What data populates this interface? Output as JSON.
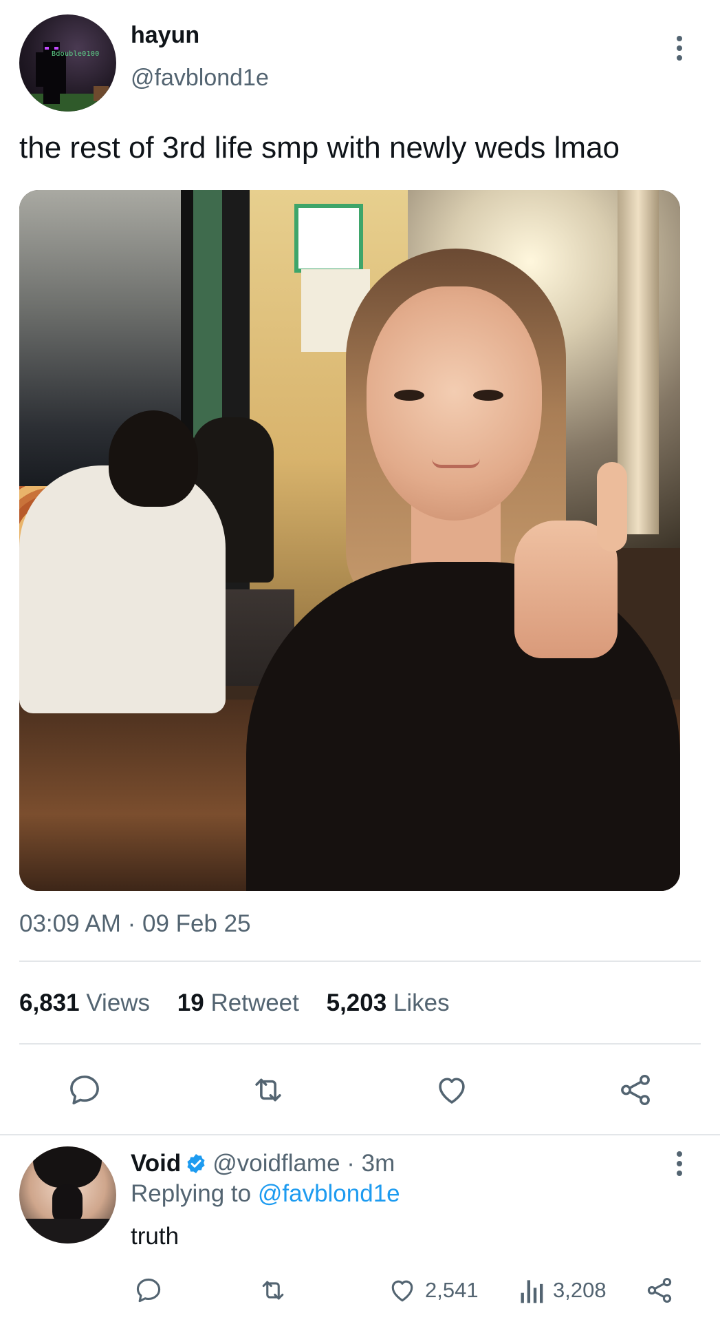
{
  "tweet": {
    "author_name": "hayun",
    "author_handle": "@favblond1e",
    "avatar_tag": "Bdouble0100",
    "text": "the rest of 3rd life smp with newly weds lmao",
    "timestamp": "03:09 AM · 09 Feb 25",
    "stats": {
      "views_count": "6,831",
      "views_label": "Views",
      "retweet_count": "19",
      "retweet_label": "Retweet",
      "likes_count": "5,203",
      "likes_label": "Likes"
    },
    "actions": [
      "reply-icon",
      "retweet-icon",
      "like-icon",
      "share-icon"
    ]
  },
  "reply": {
    "author_name": "Void",
    "author_handle": "@voidflame · 3m",
    "replying_prefix": "Replying to",
    "replying_to": "@favblond1e",
    "text": "truth",
    "like_count": "2,541",
    "views_count": "3,208",
    "actions": [
      "reply-icon",
      "retweet-icon",
      "like-icon",
      "views-icon",
      "share-icon"
    ]
  },
  "colors": {
    "text_primary": "#0f1419",
    "text_secondary": "#536471",
    "accent": "#1d9bf0",
    "divider": "#e3e6e9"
  }
}
